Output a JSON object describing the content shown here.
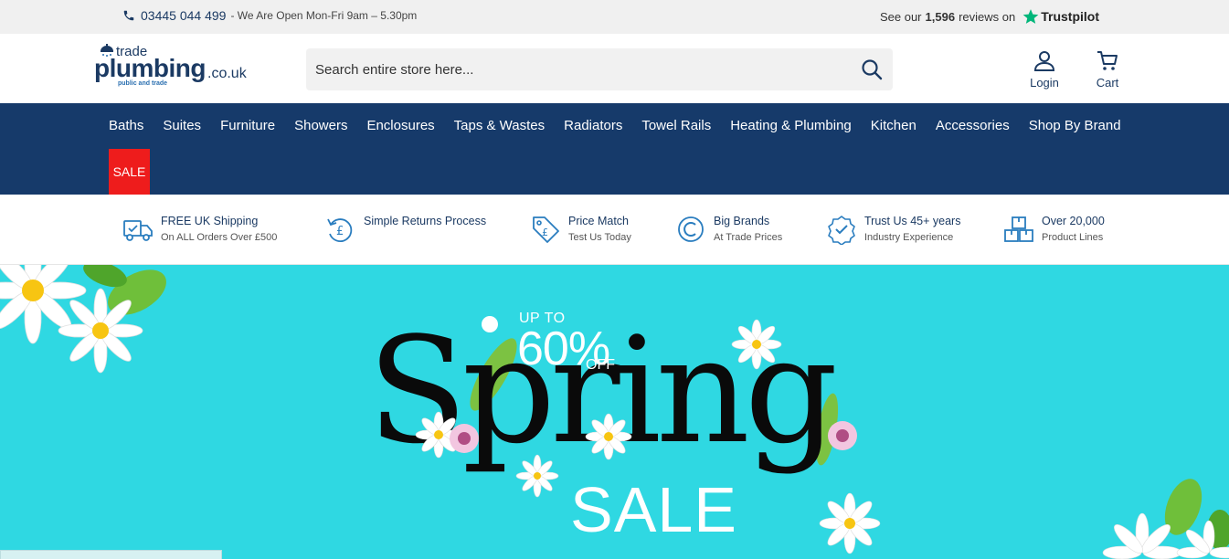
{
  "topbar": {
    "phone": "03445 044 499",
    "hours": "- We Are Open Mon-Fri 9am – 5.30pm",
    "reviews_prefix": "See our",
    "reviews_count": "1,596",
    "reviews_suffix": "reviews on",
    "trustpilot": "Trustpilot"
  },
  "header": {
    "logo": {
      "trade": "trade",
      "plumbing": "plumbing",
      "domain": ".co.uk",
      "tagline": "public and trade"
    },
    "search_placeholder": "Search entire store here...",
    "login_label": "Login",
    "cart_label": "Cart"
  },
  "nav": {
    "items": [
      "Baths",
      "Suites",
      "Furniture",
      "Showers",
      "Enclosures",
      "Taps & Wastes",
      "Radiators",
      "Towel Rails",
      "Heating & Plumbing",
      "Kitchen",
      "Accessories",
      "Shop By Brand"
    ],
    "sale": "SALE"
  },
  "usps": [
    {
      "title": "FREE UK Shipping",
      "sub": "On ALL Orders Over £500",
      "icon": "delivery-truck-icon"
    },
    {
      "title": "Simple Returns Process",
      "sub": "",
      "icon": "returns-icon"
    },
    {
      "title": "Price Match",
      "sub": "Test Us Today",
      "icon": "price-tag-icon"
    },
    {
      "title": "Big Brands",
      "sub": "At Trade Prices",
      "icon": "copyright-icon"
    },
    {
      "title": "Trust Us 45+ years",
      "sub": "Industry Experience",
      "icon": "badge-check-icon"
    },
    {
      "title": "Over 20,000",
      "sub": "Product Lines",
      "icon": "boxes-icon"
    }
  ],
  "banner": {
    "up_to": "UP TO",
    "percent": "60%",
    "off": "OFF",
    "headline": "Spring",
    "subline": "SALE"
  },
  "colors": {
    "navy": "#163a6a",
    "sale_red": "#ee1c1c",
    "banner_cyan": "#2fd8e2",
    "trustpilot_green": "#00b67a"
  }
}
